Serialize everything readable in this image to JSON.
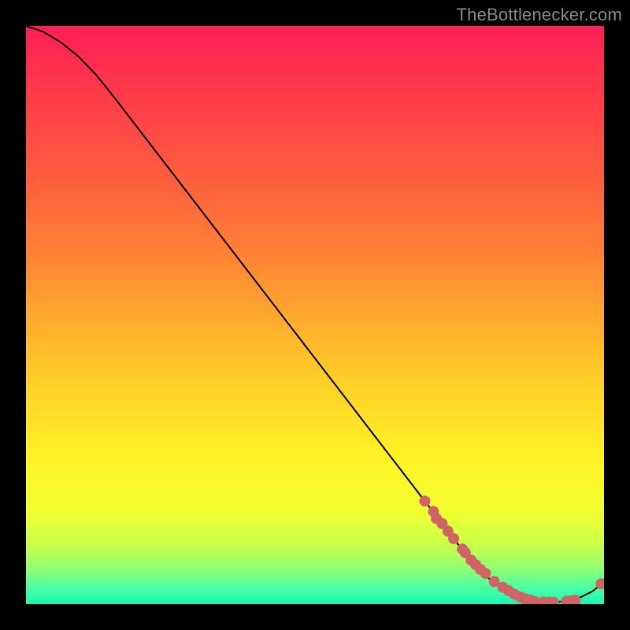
{
  "attribution": "TheBottlenecker.com",
  "chart_data": {
    "type": "line",
    "title": "",
    "xlabel": "",
    "ylabel": "",
    "xlim": [
      0,
      100
    ],
    "ylim": [
      0,
      100
    ],
    "grid": false,
    "annotations": [],
    "series": [
      {
        "name": "curve",
        "kind": "line",
        "color": "#000000",
        "x": [
          0,
          3,
          6,
          9,
          12,
          15,
          18,
          21,
          24,
          27,
          30,
          33,
          36,
          39,
          42,
          45,
          48,
          51,
          54,
          57,
          60,
          63,
          66,
          69,
          72,
          75,
          78,
          80,
          82,
          84,
          86,
          88,
          90,
          92,
          94,
          96,
          98,
          100
        ],
        "y": [
          100,
          99,
          97.2,
          94.8,
          91.7,
          88,
          84.1,
          80.2,
          76.3,
          72.4,
          68.5,
          64.6,
          60.7,
          56.8,
          52.9,
          49,
          45.1,
          41.2,
          37.3,
          33.4,
          29.5,
          25.6,
          21.7,
          17.8,
          13.9,
          10,
          6.6,
          4.5,
          2.9,
          1.7,
          0.9,
          0.45,
          0.3,
          0.35,
          0.6,
          1.2,
          2.2,
          3.8
        ]
      },
      {
        "name": "dots",
        "kind": "scatter",
        "color": "#d06464",
        "radius": 7,
        "x": [
          69,
          70.5,
          71,
          72,
          73,
          74,
          75.5,
          76,
          77,
          77.8,
          78.6,
          79.5,
          81,
          82.5,
          83.5,
          84.5,
          85.5,
          86.3,
          87.2,
          88,
          89.5,
          90.5,
          91.3,
          93.5,
          94.3,
          95,
          99.5
        ],
        "y": [
          17.8,
          16,
          14.8,
          13.9,
          12.6,
          11.3,
          9.5,
          8.9,
          7.6,
          6.8,
          6,
          5.3,
          3.9,
          2.9,
          2.3,
          1.7,
          1.2,
          0.9,
          0.7,
          0.45,
          0.35,
          0.3,
          0.3,
          0.5,
          0.55,
          0.65,
          3.5
        ]
      }
    ],
    "background_gradient": {
      "stops": [
        {
          "offset": 0.0,
          "color": "#ff1f56"
        },
        {
          "offset": 0.12,
          "color": "#ff3b4a"
        },
        {
          "offset": 0.25,
          "color": "#ff5a3f"
        },
        {
          "offset": 0.38,
          "color": "#ff7d36"
        },
        {
          "offset": 0.5,
          "color": "#ffa82f"
        },
        {
          "offset": 0.62,
          "color": "#ffd028"
        },
        {
          "offset": 0.74,
          "color": "#fff126"
        },
        {
          "offset": 0.84,
          "color": "#f2ff2f"
        },
        {
          "offset": 0.9,
          "color": "#c6ff4a"
        },
        {
          "offset": 0.94,
          "color": "#8dff73"
        },
        {
          "offset": 0.97,
          "color": "#4fffa1"
        },
        {
          "offset": 1.0,
          "color": "#18f7b4"
        }
      ]
    }
  }
}
